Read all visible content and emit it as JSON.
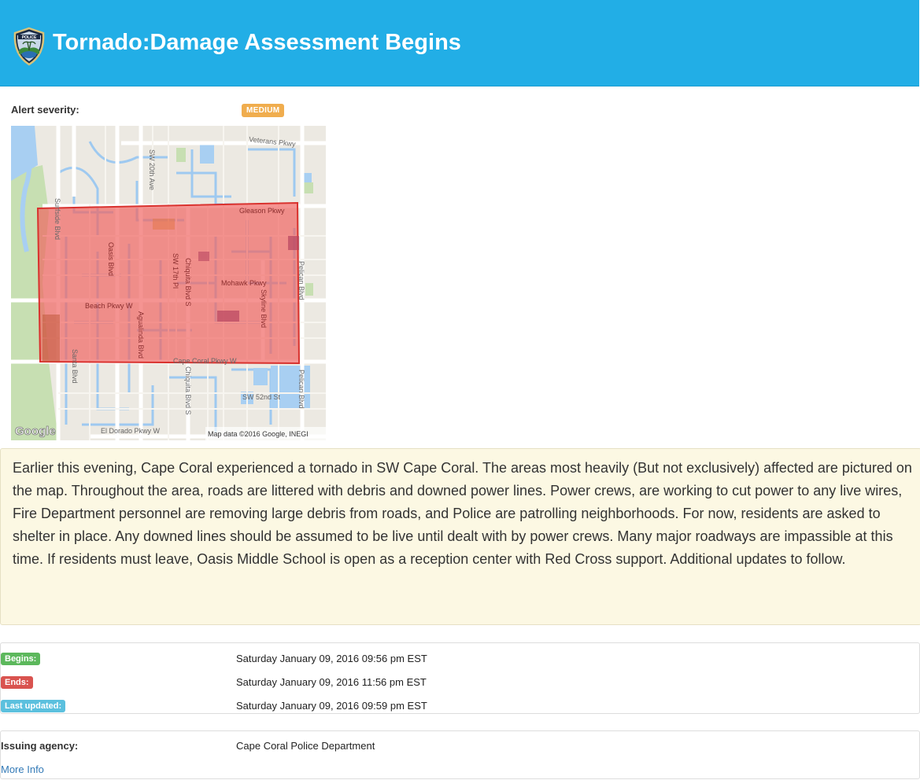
{
  "header": {
    "title": "Tornado:Damage Assessment Begins",
    "logo_icon": "police-badge-icon",
    "logo_text": "POLICE",
    "background_color": "#22aee6"
  },
  "severity": {
    "label": "Alert severity:",
    "value": "MEDIUM",
    "color": "#f0ad4e"
  },
  "map": {
    "attribution": "Map data ©2016 Google, INEGI",
    "logo": "Google",
    "highlight_color": "#f0625f",
    "streets": {
      "veterans": "Veterans Pkwy",
      "sw20th": "SW 20th Ave",
      "surfside": "Surfside Blvd",
      "gleason": "Gleason Pkwy",
      "oasis": "Oasis Blvd",
      "sw17th": "SW 17th Pl",
      "chiquita": "Chiquita Blvd S",
      "mohawk": "Mohawk Pkwy",
      "pelican": "Pelican Blvd",
      "beach": "Beach Pkwy W",
      "agualinda": "Agualinda Blvd",
      "skyline": "Skyline Blvd",
      "santa": "Santa Blvd",
      "capecoral": "Cape Coral Pkwy W",
      "sw52nd": "SW 52nd St",
      "eldorado": "El Dorado Pkwy W"
    }
  },
  "description": "Earlier this evening, Cape Coral experienced a tornado in SW Cape Coral. The areas most heavily (But not exclusively) affected are pictured on the map. Throughout the area, roads are littered with debris and downed power lines. Power crews, are working to cut power to any live wires, Fire Department personnel are removing large debris from roads, and Police are patrolling neighborhoods. For now, residents are asked to shelter in place. Any downed lines should be assumed to be live until dealt with by power crews. Many major roadways are impassible at this time. If residents must leave, Oasis Middle School is open as a reception center with Red Cross support. Additional updates to follow.",
  "times": [
    {
      "label": "Begins:",
      "value": "Saturday January 09, 2016 09:56 pm EST",
      "color": "#5cb85c"
    },
    {
      "label": "Ends:",
      "value": "Saturday January 09, 2016 11:56 pm EST",
      "color": "#d9534f"
    },
    {
      "label": "Last updated:",
      "value": "Saturday January 09, 2016 09:59 pm EST",
      "color": "#5bc0de"
    }
  ],
  "agency": {
    "label": "Issuing agency:",
    "value": "Cape Coral Police Department",
    "more_info": "More Info"
  }
}
